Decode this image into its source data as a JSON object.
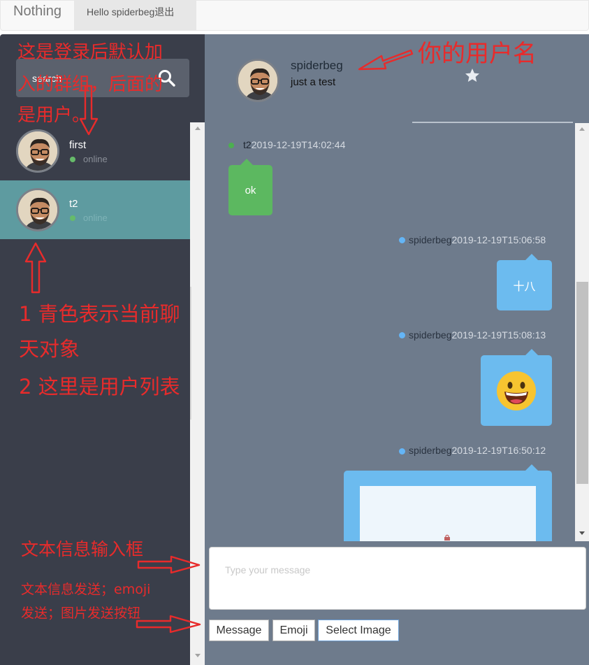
{
  "navbar": {
    "brand": "Nothing",
    "user_link": "Hello spiderbeg退出"
  },
  "search": {
    "value": "search",
    "placeholder": "search"
  },
  "users": [
    {
      "name": "first",
      "status": "online",
      "active": false
    },
    {
      "name": "t2",
      "status": "online",
      "active": true
    }
  ],
  "chat_header": {
    "name": "spiderbeg",
    "status": "just a test"
  },
  "messages": [
    {
      "sender": "t2",
      "time": "2019-12-19T14:02:44",
      "text": "ok",
      "side": "left"
    },
    {
      "sender": "spiderbeg",
      "time": "2019-12-19T15:06:58",
      "text": "十八",
      "side": "right"
    },
    {
      "sender": "spiderbeg",
      "time": "2019-12-19T15:08:13",
      "emoji": "grinning-face",
      "side": "right"
    },
    {
      "sender": "spiderbeg",
      "time": "2019-12-19T16:50:12",
      "image": "broken-image",
      "side": "right"
    }
  ],
  "composer": {
    "placeholder": "Type your message",
    "buttons": {
      "message": "Message",
      "emoji": "Emoji",
      "image": "Select Image"
    }
  },
  "annotations": {
    "default_group": [
      "这是登录后默认加",
      "入的群组，后面的",
      "是用户。"
    ],
    "username": "你的用户名",
    "current_chat": [
      "1 青色表示当前聊",
      "天对象"
    ],
    "user_list": "2 这里是用户列表",
    "text_input": "文本信息输入框",
    "send_buttons": [
      "文本信息发送；emoji",
      "发送；图片发送按钮"
    ]
  },
  "colors": {
    "sidebar": "#3a3e4a",
    "main": "#6e7b8c",
    "active_user": "#5e9ba0",
    "bubble_green": "#5cb860",
    "bubble_blue": "#6cbbef",
    "annotation": "#e82b2b"
  },
  "icons": [
    "search-icon",
    "star-icon",
    "avatar",
    "grinning-emoji-icon",
    "broken-image-icon"
  ]
}
